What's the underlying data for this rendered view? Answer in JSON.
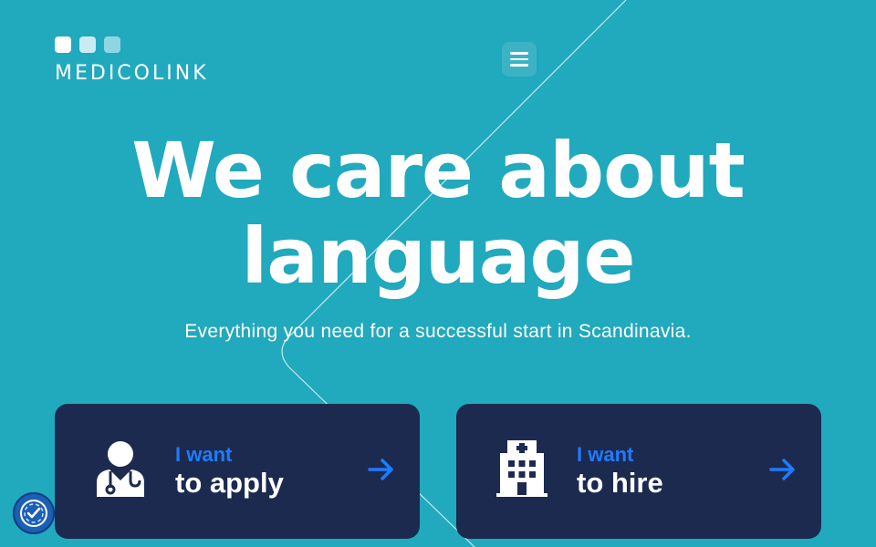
{
  "brand": {
    "name": "MEDICOLINK",
    "dot_colors": [
      "#ffffff",
      "#c9ecf2",
      "#8fd6e2"
    ]
  },
  "header": {
    "menu_icon": "hamburger-menu-icon"
  },
  "hero": {
    "title_line1": "We care about",
    "title_line2": "language",
    "subtitle": "Everything you need for a successful start in Scandinavia."
  },
  "cards": [
    {
      "kicker": "I want",
      "label": "to apply",
      "icon": "doctor-icon",
      "arrow_icon": "arrow-right-icon"
    },
    {
      "kicker": "I want",
      "label": "to hire",
      "icon": "hospital-icon",
      "arrow_icon": "arrow-right-icon"
    }
  ],
  "accessibility": {
    "icon": "accessibility-icon"
  },
  "colors": {
    "background": "#21a9bd",
    "card": "#1c2a4f",
    "accent": "#1f7bff"
  }
}
